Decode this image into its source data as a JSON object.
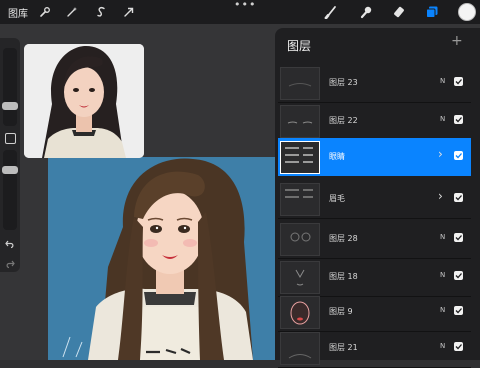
{
  "toolbar": {
    "gallery_label": "图库",
    "left_tools": [
      {
        "icon": "wrench-icon"
      },
      {
        "icon": "magic-wand-icon"
      },
      {
        "icon": "selection-s-icon"
      },
      {
        "icon": "transform-arrow-icon"
      }
    ],
    "more_label": "•••",
    "right_tools": [
      {
        "icon": "brush-icon"
      },
      {
        "icon": "smudge-icon"
      },
      {
        "icon": "eraser-icon"
      },
      {
        "icon": "layers-icon",
        "active": true
      }
    ],
    "current_color": "#f4f4f4"
  },
  "layers_panel": {
    "title": "图层",
    "add_label": "+",
    "layers": [
      {
        "name": "图层 23",
        "blend": "N",
        "visible": true,
        "active": false
      },
      {
        "name": "图层 22",
        "blend": "N",
        "visible": true,
        "active": false
      },
      {
        "name": "眼睛",
        "group": true,
        "visible": true,
        "active": true
      },
      {
        "name": "眉毛",
        "group": true,
        "visible": true,
        "active": false
      },
      {
        "name": "图层 28",
        "blend": "N",
        "visible": true,
        "active": false
      },
      {
        "name": "图层 18",
        "blend": "N",
        "visible": true,
        "active": false
      },
      {
        "name": "图层 9",
        "blend": "N",
        "visible": true,
        "active": false
      },
      {
        "name": "图层 21",
        "blend": "N",
        "visible": true,
        "active": false
      }
    ]
  },
  "colors": {
    "accent": "#0a84ff",
    "canvas_bg": "#3e7fa8"
  }
}
